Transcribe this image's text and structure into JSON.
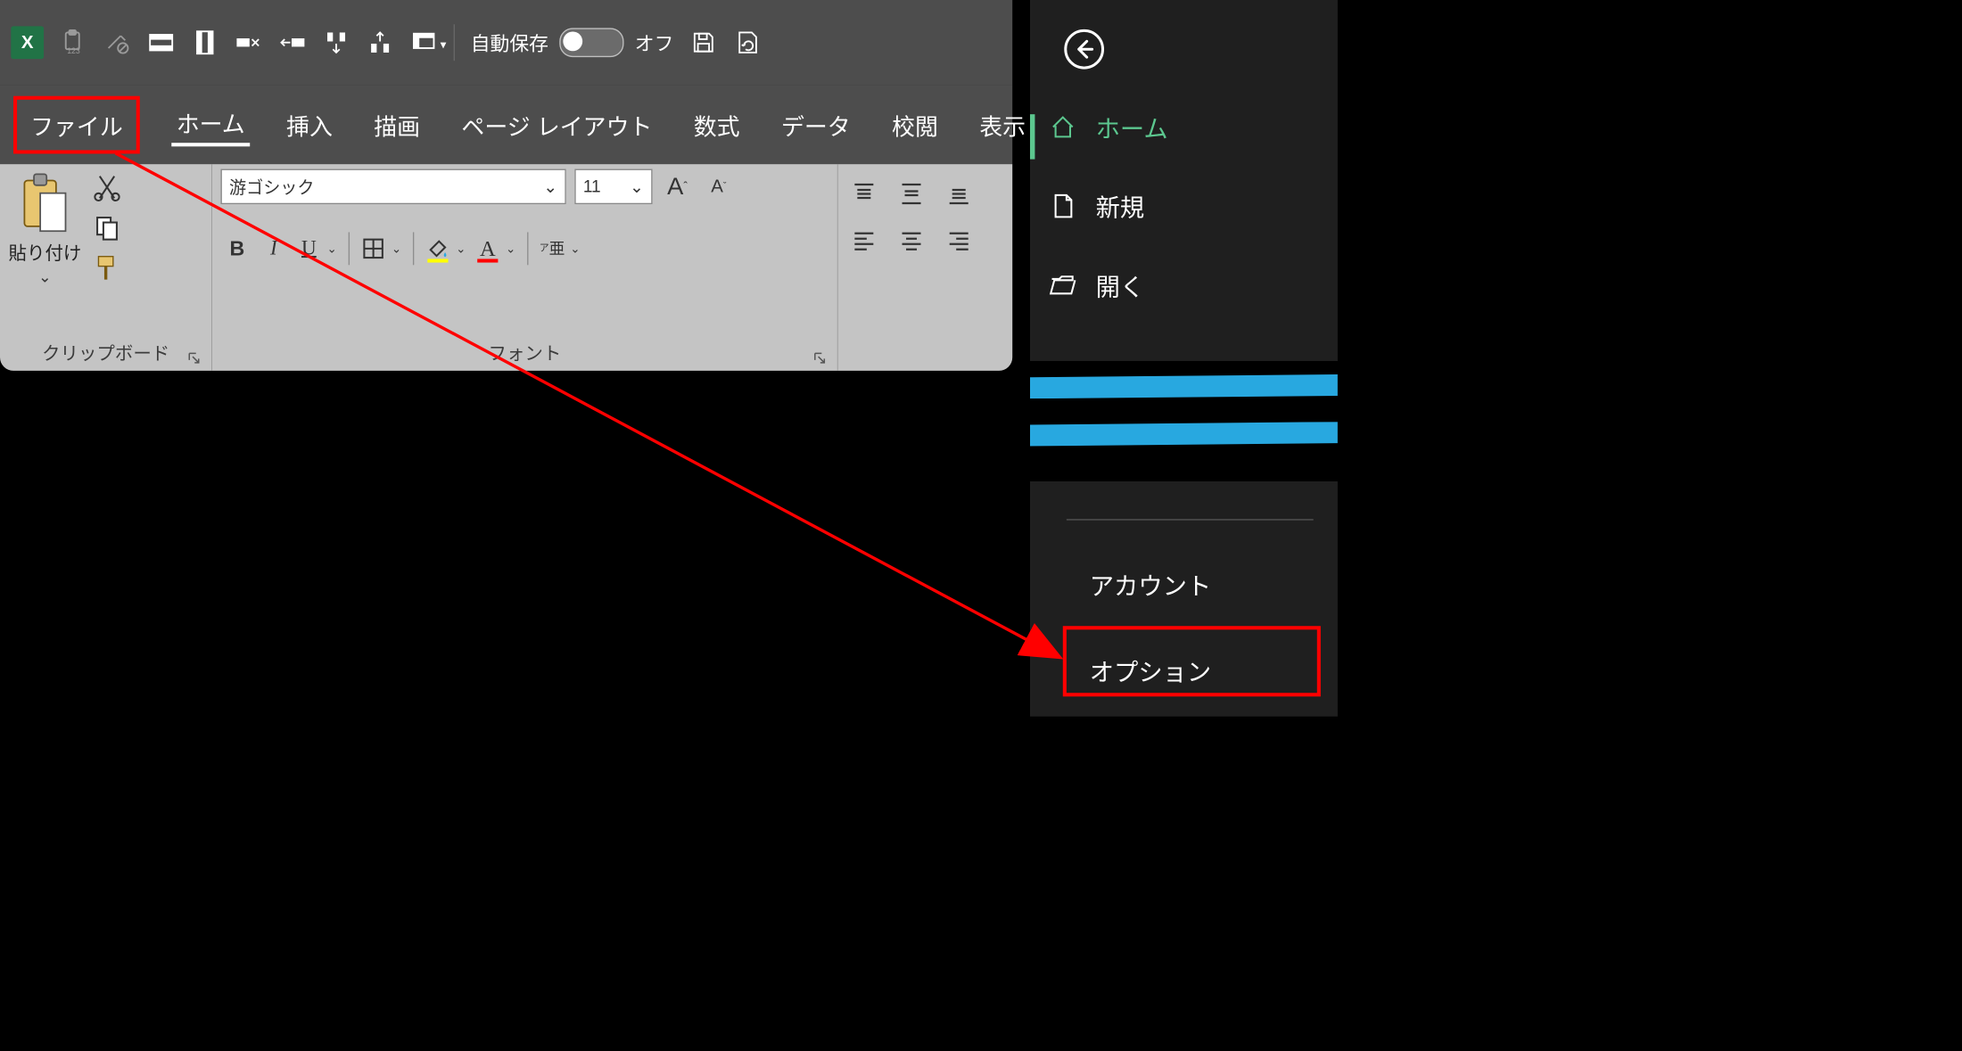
{
  "qat": {
    "autosave_label": "自動保存",
    "autosave_state": "オフ"
  },
  "tabs": {
    "file": "ファイル",
    "home": "ホーム",
    "insert": "挿入",
    "draw": "描画",
    "pagelayout": "ページ レイアウト",
    "formulas": "数式",
    "data": "データ",
    "review": "校閲",
    "view": "表示"
  },
  "ribbon": {
    "clipboard": {
      "paste": "貼り付け",
      "label": "クリップボード"
    },
    "font": {
      "name": "游ゴシック",
      "size": "11",
      "label": "フォント",
      "bold": "B",
      "italic": "I",
      "underline": "U"
    }
  },
  "backstage": {
    "home": "ホーム",
    "new": "新規",
    "open": "開く",
    "account": "アカウント",
    "options": "オプション"
  }
}
